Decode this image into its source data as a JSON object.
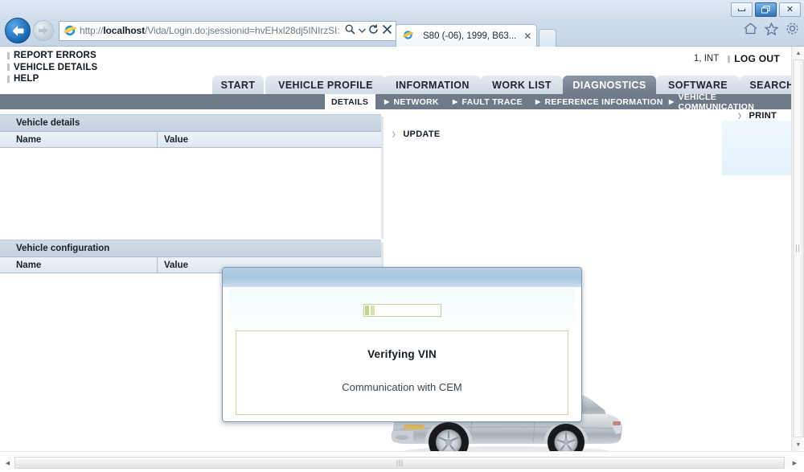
{
  "browser": {
    "url_prefix": "http://",
    "url_host": "localhost",
    "url_path": "/Vida/Login.do;jsessionid=hvEHxl28dj5INIrzSI:",
    "back_icon": "back-arrow-icon",
    "forward_icon": "forward-arrow-icon",
    "search_icon": "magnifier-icon",
    "dropdown_icon": "chevron-down-icon",
    "refresh_icon": "refresh-icon",
    "stop_icon": "close-icon",
    "tab_title": "S80 (-06), 1999, B63...",
    "tab_close": "✕",
    "home_icon": "home-icon",
    "favorites_icon": "star-icon",
    "tools_icon": "gear-icon",
    "minimize_label": "minimize",
    "restore_label": "restore",
    "close_label": "✕"
  },
  "header": {
    "menu": [
      {
        "label": "REPORT ERRORS"
      },
      {
        "label": "VEHICLE DETAILS"
      },
      {
        "label": "HELP"
      }
    ],
    "user_id": "1, INT",
    "logout_label": "LOG OUT"
  },
  "tabs": {
    "items": [
      {
        "label": "START",
        "active": false
      },
      {
        "label": "VEHICLE PROFILE",
        "active": false
      },
      {
        "label": "INFORMATION",
        "active": false
      },
      {
        "label": "WORK LIST",
        "active": false
      },
      {
        "label": "DIAGNOSTICS",
        "active": true
      },
      {
        "label": "SOFTWARE",
        "active": false
      },
      {
        "label": "SEARCH",
        "active": false
      }
    ],
    "active_color": "#6e7a88"
  },
  "subnav": {
    "items": [
      {
        "label": "DETAILS",
        "active": true
      },
      {
        "label": "NETWORK",
        "active": false
      },
      {
        "label": "FAULT TRACE",
        "active": false
      },
      {
        "label": "REFERENCE INFORMATION",
        "active": false
      },
      {
        "label": "VEHICLE COMMUNICATION",
        "active": false
      }
    ],
    "arrow_glyph": "▶"
  },
  "content": {
    "print_label": "PRINT",
    "update_label": "UPDATE",
    "arrow_glyph": "〉",
    "panels": [
      {
        "title": "Vehicle details",
        "columns": [
          "Name",
          "Value"
        ],
        "rows": []
      },
      {
        "title": "Vehicle configuration",
        "columns": [
          "Name",
          "Value"
        ],
        "rows": []
      }
    ],
    "vehicle_image": "volvo-s80-sedan-silver"
  },
  "modal": {
    "title": "",
    "progress_segments": 2,
    "progress_color": "#c4d48a",
    "message_title": "Verifying VIN",
    "message_sub": "Communication with CEM"
  },
  "scrollbars": {
    "vertical_up": "▲",
    "vertical_down": "▼",
    "horizontal_left": "◀",
    "horizontal_right": "▶"
  }
}
